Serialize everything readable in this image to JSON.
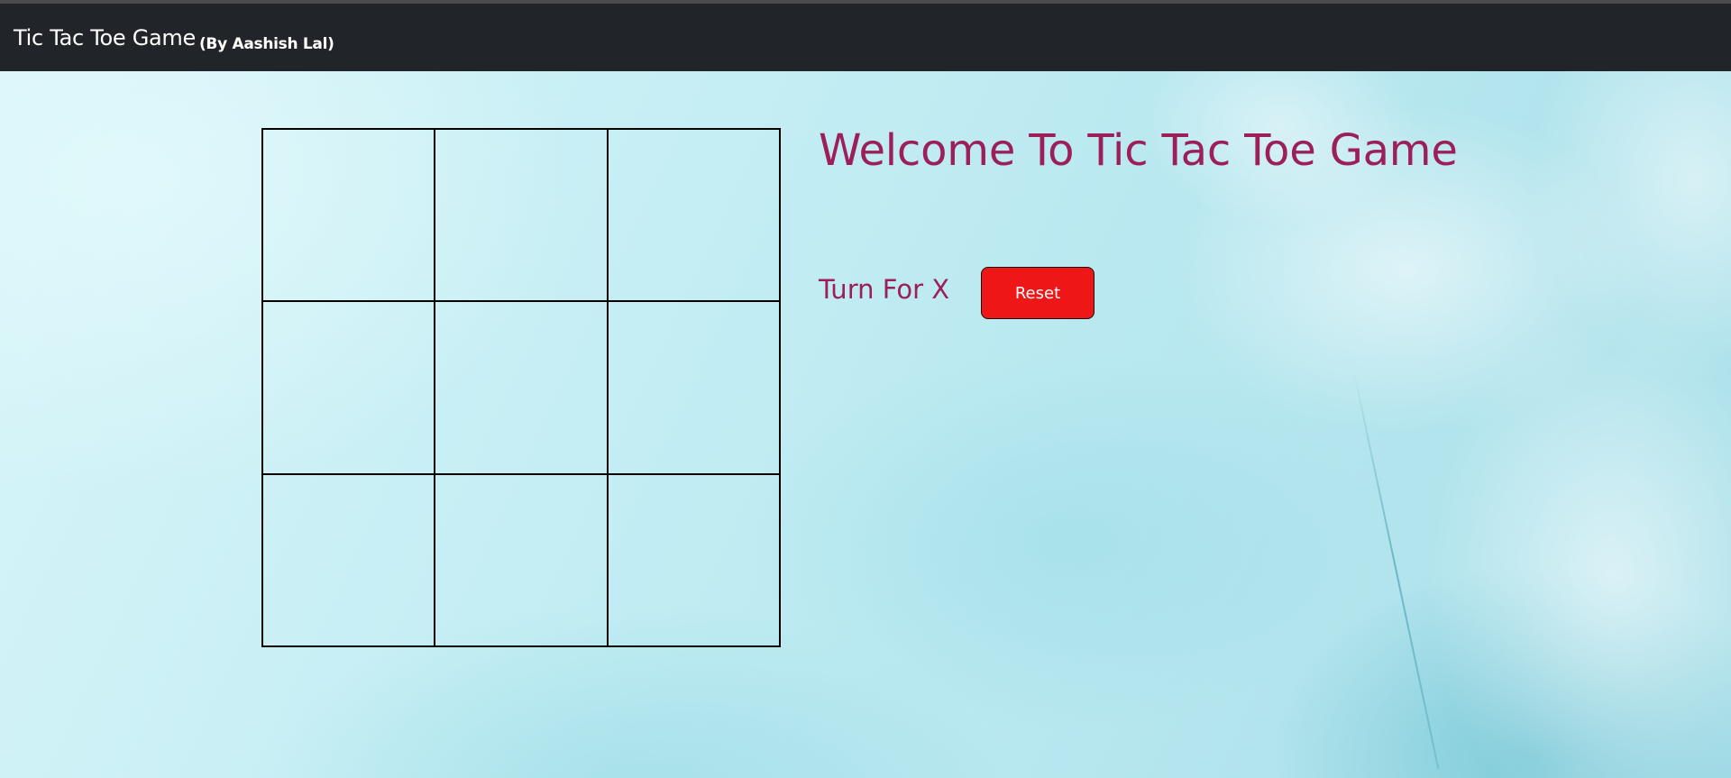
{
  "navbar": {
    "title": "Tic Tac Toe Game",
    "subtitle": "(By Aashish Lal)"
  },
  "game": {
    "heading": "Welcome To Tic Tac Toe Game",
    "turn_text": "Turn For X",
    "reset_label": "Reset",
    "board": [
      "",
      "",
      "",
      "",
      "",
      "",
      "",
      "",
      ""
    ]
  },
  "colors": {
    "navbar_bg": "#212428",
    "heading": "#9c1f5a",
    "reset_button": "#ee1617"
  }
}
